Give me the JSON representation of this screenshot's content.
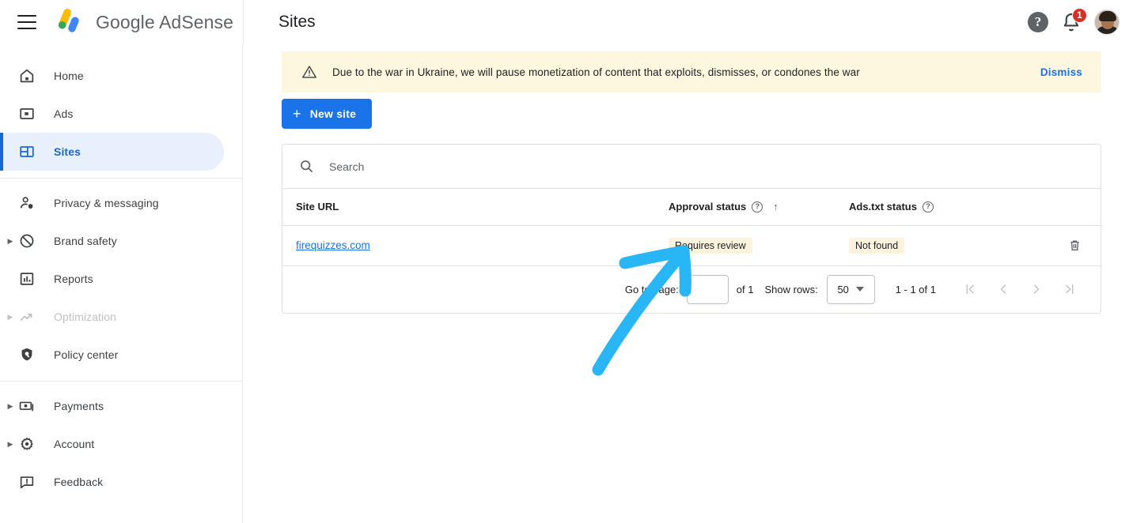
{
  "topbar": {
    "menu_icon": "hamburger-menu-icon",
    "brand": "Google AdSense",
    "page_title": "Sites",
    "help_icon": "help-icon",
    "help_label": "?",
    "notifications_icon": "bell-icon",
    "notifications_count": "1",
    "avatar_label": "avatar"
  },
  "sidebar": {
    "items": [
      {
        "label": "Home",
        "icon": "home-icon",
        "active": false,
        "expandable": false,
        "disabled": false
      },
      {
        "label": "Ads",
        "icon": "ads-icon",
        "active": false,
        "expandable": false,
        "disabled": false
      },
      {
        "label": "Sites",
        "icon": "sites-icon",
        "active": true,
        "expandable": false,
        "disabled": false
      },
      {
        "label": "Privacy & messaging",
        "icon": "privacy-icon",
        "active": false,
        "expandable": false,
        "disabled": false
      },
      {
        "label": "Brand safety",
        "icon": "brand-safety-icon",
        "active": false,
        "expandable": true,
        "disabled": false
      },
      {
        "label": "Reports",
        "icon": "reports-icon",
        "active": false,
        "expandable": false,
        "disabled": false
      },
      {
        "label": "Optimization",
        "icon": "optimization-icon",
        "active": false,
        "expandable": true,
        "disabled": true
      },
      {
        "label": "Policy center",
        "icon": "policy-center-icon",
        "active": false,
        "expandable": false,
        "disabled": false
      },
      {
        "label": "Payments",
        "icon": "payments-icon",
        "active": false,
        "expandable": true,
        "disabled": false
      },
      {
        "label": "Account",
        "icon": "account-gear-icon",
        "active": false,
        "expandable": true,
        "disabled": false
      },
      {
        "label": "Feedback",
        "icon": "feedback-icon",
        "active": false,
        "expandable": false,
        "disabled": false
      }
    ]
  },
  "banner": {
    "icon": "warning-triangle-icon",
    "text": "Due to the war in Ukraine, we will pause monetization of content that exploits, dismisses, or condones the war",
    "dismiss_label": "Dismiss"
  },
  "actions": {
    "new_site_label": "New site",
    "new_site_icon": "plus-icon"
  },
  "search": {
    "icon": "search-icon",
    "placeholder": "Search",
    "value": ""
  },
  "table": {
    "columns": [
      {
        "label": "Site URL",
        "help": false,
        "sorted": false
      },
      {
        "label": "Approval status",
        "help": true,
        "sorted": true
      },
      {
        "label": "Ads.txt status",
        "help": true,
        "sorted": false
      }
    ],
    "sort_arrow": "↑",
    "help_glyph": "?",
    "rows": [
      {
        "site_url": "firequizzes.com",
        "approval_status": "Requires review",
        "ads_txt_status": "Not found",
        "delete_icon": "trash-icon"
      }
    ]
  },
  "pagination": {
    "go_to_page_label": "Go to page:",
    "page_value": "",
    "of_label": "of 1",
    "show_rows_label": "Show rows:",
    "rows_value": "50",
    "range_label": "1 - 1 of 1",
    "first_icon": "first-page-icon",
    "prev_icon": "previous-page-icon",
    "next_icon": "next-page-icon",
    "last_icon": "last-page-icon"
  },
  "annotation": {
    "shape": "hand-drawn-arrow",
    "color": "#29B6F6",
    "points_to": "Requires review"
  },
  "colors": {
    "accent_blue": "#1a73e8",
    "active_nav_bg": "#e8f0fe",
    "active_nav_fg": "#1967d2",
    "banner_bg": "#fef7e0",
    "chip_bg": "#fdf3dc",
    "badge_red": "#d93025",
    "annotation_cyan": "#29B6F6"
  }
}
